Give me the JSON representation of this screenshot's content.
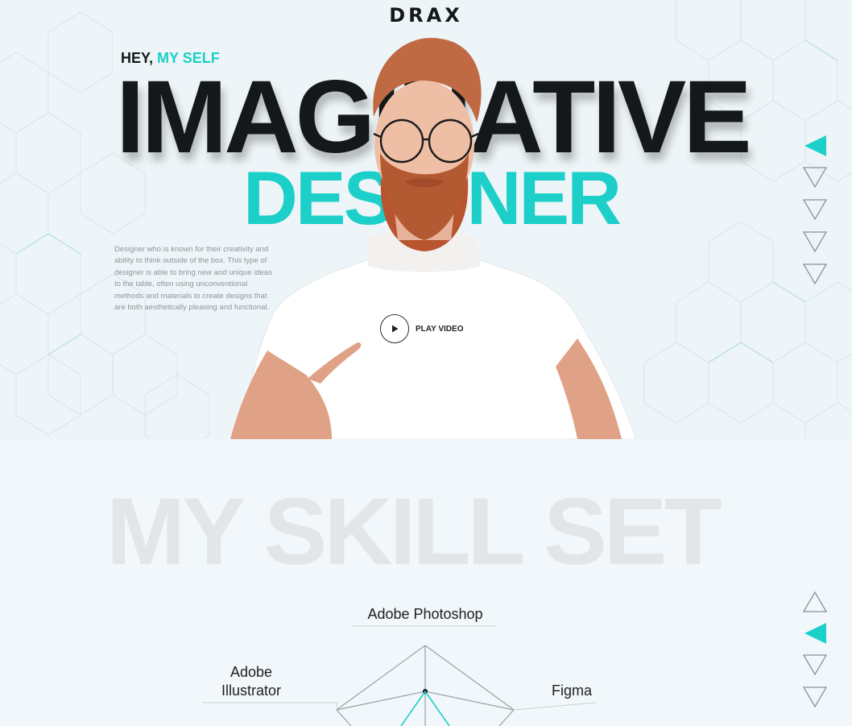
{
  "brand": {
    "logo": "DRAX"
  },
  "hero": {
    "greeting_prefix": "HEY,",
    "greeting_accent": "MY SELF",
    "title": "IMAGINATIVE",
    "subtitle": "DESIGNER",
    "description": "Designer who is known for their creativity and ability to think outside of the box. This type of designer is able to bring new and unique ideas to the table, often using unconventional methods and materials to create designs that are both aesthetically pleasing and functional.",
    "play_label": "PLAY VIDEO"
  },
  "skills": {
    "title": "MY SKILL SET",
    "items": [
      "Adobe Photoshop",
      "Adobe Illustrator",
      "Figma"
    ]
  },
  "colors": {
    "accent": "#1ccfc9",
    "text": "#151818",
    "background": "#f1f7fa"
  },
  "nav": {
    "hero_active_index": 0,
    "hero_count": 5,
    "skills_active_index": 1,
    "skills_count": 5
  }
}
